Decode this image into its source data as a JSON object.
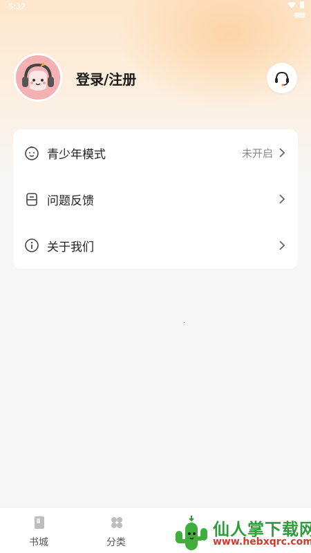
{
  "status_bar": {
    "time": "5:32",
    "badge": "8db"
  },
  "profile": {
    "login_label": "登录/注册",
    "avatar_icon": "headphone-character-avatar",
    "support_icon": "headset-icon"
  },
  "menu": {
    "items": [
      {
        "label": "青少年模式",
        "value": "未开启",
        "icon": "child-face-icon"
      },
      {
        "label": "问题反馈",
        "value": "",
        "icon": "feedback-icon"
      },
      {
        "label": "关于我们",
        "value": "",
        "icon": "info-icon"
      }
    ]
  },
  "tabbar": {
    "tabs": [
      {
        "label": "书城",
        "icon": "book-icon"
      },
      {
        "label": "分类",
        "icon": "category-icon"
      }
    ]
  },
  "watermark": {
    "title": "仙人掌下载网",
    "url": "www.hebxqrc.com"
  },
  "colors": {
    "accent": "#f3b1b3",
    "brand_green": "#2f9b3a",
    "brand_red": "#d23a2b"
  }
}
